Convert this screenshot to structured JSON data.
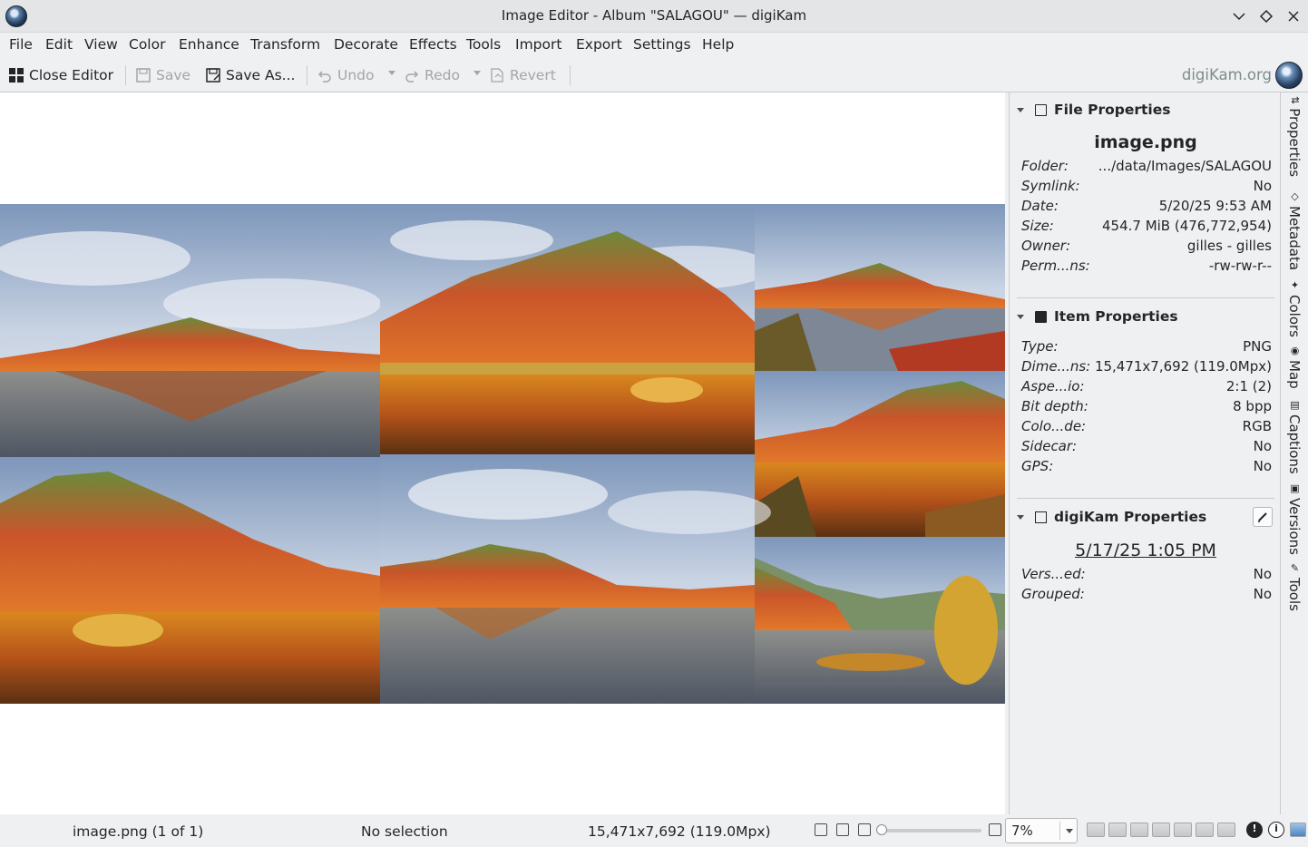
{
  "window": {
    "title": "Image Editor - Album \"SALAGOU\" — digiKam"
  },
  "menu": [
    "File",
    "Edit",
    "View",
    "Color",
    "Enhance",
    "Transform",
    "Decorate",
    "Effects",
    "Tools",
    "Import",
    "Export",
    "Settings",
    "Help"
  ],
  "toolbar": {
    "close_editor": "Close Editor",
    "save": "Save",
    "save_as": "Save As...",
    "undo": "Undo",
    "redo": "Redo",
    "revert": "Revert",
    "brand": "digiKam.org"
  },
  "file_properties": {
    "title": "File Properties",
    "filename": "image.png",
    "rows": [
      {
        "k": "Folder:",
        "v": ".../data/Images/SALAGOU"
      },
      {
        "k": "Symlink:",
        "v": "No"
      },
      {
        "k": "Date:",
        "v": "5/20/25 9:53 AM"
      },
      {
        "k": "Size:",
        "v": "454.7 MiB (476,772,954)"
      },
      {
        "k": "Owner:",
        "v": "gilles - gilles"
      },
      {
        "k": "Perm...ns:",
        "v": "-rw-rw-r--"
      }
    ]
  },
  "item_properties": {
    "title": "Item Properties",
    "rows": [
      {
        "k": "Type:",
        "v": "PNG"
      },
      {
        "k": "Dime...ns:",
        "v": "15,471x7,692 (119.0Mpx)"
      },
      {
        "k": "Aspe...io:",
        "v": "2:1 (2)"
      },
      {
        "k": "Bit depth:",
        "v": "8 bpp"
      },
      {
        "k": "Colo...de:",
        "v": "RGB"
      },
      {
        "k": "Sidecar:",
        "v": "No"
      },
      {
        "k": "GPS:",
        "v": "No"
      }
    ]
  },
  "digikam_properties": {
    "title": "digiKam Properties",
    "date": "5/17/25 1:05 PM",
    "rows": [
      {
        "k": "Vers...ed:",
        "v": "No"
      },
      {
        "k": "Grouped:",
        "v": "No"
      }
    ]
  },
  "sidebar_tabs": [
    "Properties",
    "Metadata",
    "Colors",
    "Map",
    "Captions",
    "Versions",
    "Tools"
  ],
  "status": {
    "file": "image.png (1 of 1)",
    "selection": "No selection",
    "dimensions": "15,471x7,692 (119.0Mpx)",
    "zoom": "7%",
    "zoom_slider_fraction": 0.0
  },
  "colors": {
    "accent": "#3daee9",
    "text": "#232629"
  }
}
